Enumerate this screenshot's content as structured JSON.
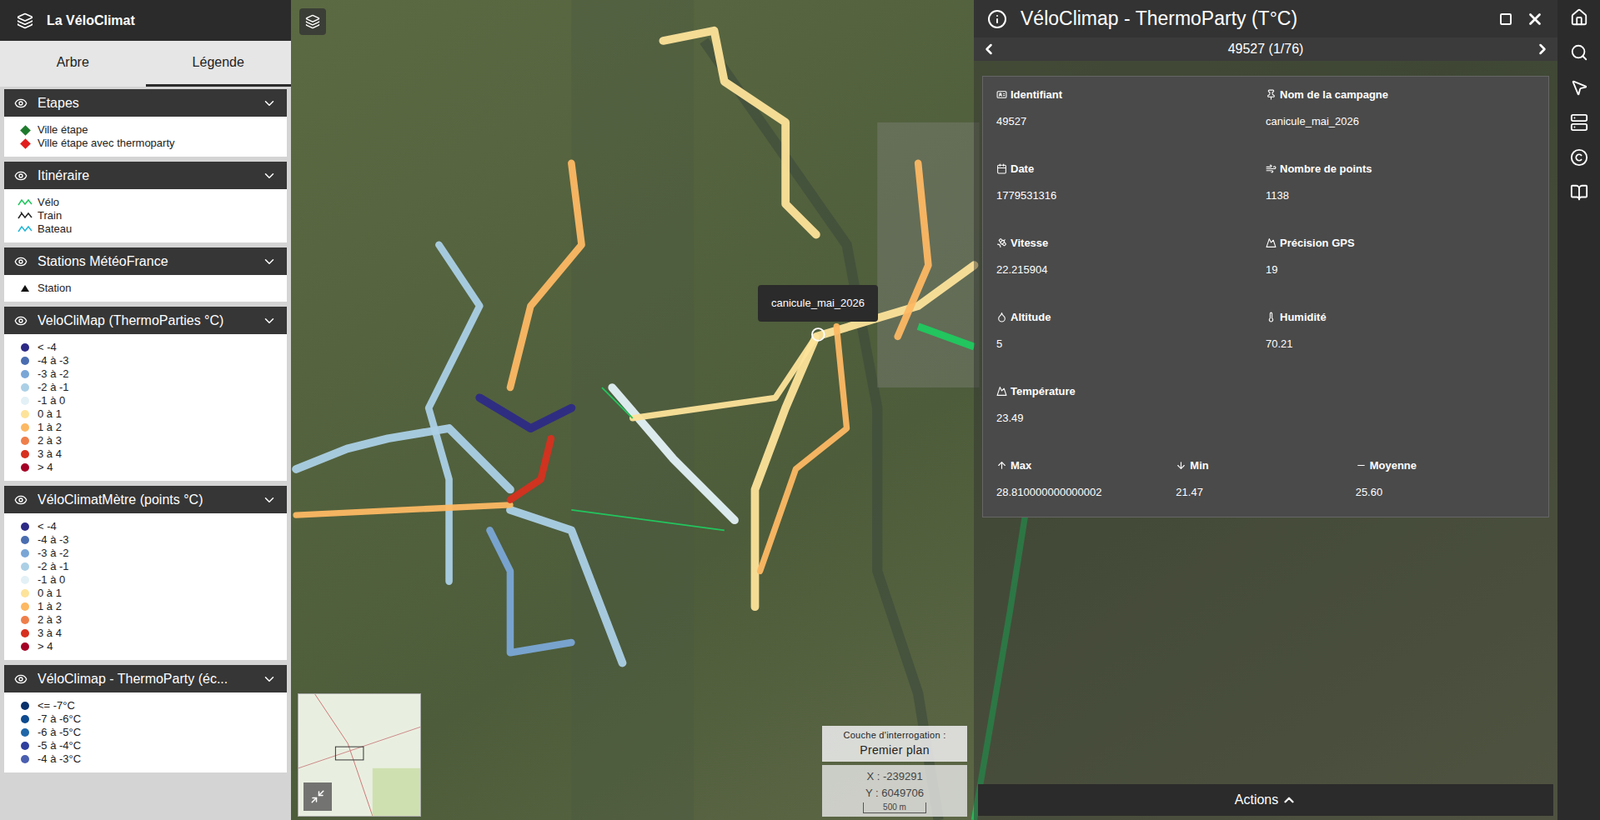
{
  "sidebar": {
    "title": "La VéloClimat",
    "tabs": [
      {
        "label": "Arbre",
        "selected": false
      },
      {
        "label": "Légende",
        "selected": true
      }
    ],
    "groups": [
      {
        "title": "Etapes",
        "expanded": true,
        "items": [
          {
            "label": "Ville étape",
            "kind": "diamond",
            "color": "#1f7a2e"
          },
          {
            "label": "Ville étape avec thermoparty",
            "kind": "diamond",
            "color": "#e11d1d"
          }
        ]
      },
      {
        "title": "Itinéraire",
        "expanded": true,
        "items": [
          {
            "label": "Vélo",
            "kind": "line",
            "color": "#22c55e"
          },
          {
            "label": "Train",
            "kind": "cross-line",
            "color": "#222222"
          },
          {
            "label": "Bateau",
            "kind": "line",
            "color": "#22b5d6"
          }
        ]
      },
      {
        "title": "Stations MétéoFrance",
        "expanded": true,
        "items": [
          {
            "label": "Station",
            "kind": "triangle",
            "color": "#111111"
          }
        ]
      },
      {
        "title": "VeloCliMap (ThermoParties °C)",
        "expanded": true,
        "items": [
          {
            "label": "< -4",
            "kind": "dot",
            "color": "#2d2a86"
          },
          {
            "label": "-4 à -3",
            "kind": "dot",
            "color": "#4a6db0"
          },
          {
            "label": "-3 à -2",
            "kind": "dot",
            "color": "#7aa6d6"
          },
          {
            "label": "-2 à -1",
            "kind": "dot",
            "color": "#abd0e6"
          },
          {
            "label": "-1 à 0",
            "kind": "dot",
            "color": "#e3f1f6"
          },
          {
            "label": "0 à 1",
            "kind": "dot",
            "color": "#fde39a"
          },
          {
            "label": "1 à 2",
            "kind": "dot",
            "color": "#fdb863"
          },
          {
            "label": "2 à 3",
            "kind": "dot",
            "color": "#ef7f4a"
          },
          {
            "label": "3 à 4",
            "kind": "dot",
            "color": "#d7301f"
          },
          {
            "label": "> 4",
            "kind": "dot",
            "color": "#a50026"
          }
        ]
      },
      {
        "title": "VéloClimatMètre (points °C)",
        "expanded": true,
        "items": [
          {
            "label": "< -4",
            "kind": "dot",
            "color": "#2d2a86"
          },
          {
            "label": "-4 à -3",
            "kind": "dot",
            "color": "#4a6db0"
          },
          {
            "label": "-3 à -2",
            "kind": "dot",
            "color": "#7aa6d6"
          },
          {
            "label": "-2 à -1",
            "kind": "dot",
            "color": "#abd0e6"
          },
          {
            "label": "-1 à 0",
            "kind": "dot",
            "color": "#e3f1f6"
          },
          {
            "label": "0 à 1",
            "kind": "dot",
            "color": "#fde39a"
          },
          {
            "label": "1 à 2",
            "kind": "dot",
            "color": "#fdb863"
          },
          {
            "label": "2 à 3",
            "kind": "dot",
            "color": "#ef7f4a"
          },
          {
            "label": "3 à 4",
            "kind": "dot",
            "color": "#d7301f"
          },
          {
            "label": "> 4",
            "kind": "dot",
            "color": "#a50026"
          }
        ]
      },
      {
        "title": "VéloClimap - ThermoParty (éc...",
        "expanded": true,
        "items": [
          {
            "label": "<= -7°C",
            "kind": "dot",
            "color": "#08306b"
          },
          {
            "label": "-7 à -6°C",
            "kind": "dot",
            "color": "#0d4a8f"
          },
          {
            "label": "-6 à -5°C",
            "kind": "dot",
            "color": "#1f66a8"
          },
          {
            "label": "-5 à -4°C",
            "kind": "dot",
            "color": "#2f3f9e"
          },
          {
            "label": "-4 à -3°C",
            "kind": "dot",
            "color": "#4a5fb0"
          }
        ]
      }
    ]
  },
  "map": {
    "tooltip": "canicule_mai_2026",
    "query_layer": {
      "label": "Couche d'interrogation :",
      "value": "Premier plan"
    },
    "coords": {
      "x": "X : -239291",
      "y": "Y : 6049706"
    },
    "scale": "500 m"
  },
  "panel": {
    "title": "VéloClimap - ThermoParty (T°C)",
    "nav": "49527 (1/76)",
    "fields": [
      {
        "label": "Identifiant",
        "value": "49527"
      },
      {
        "label": "Nom de la campagne",
        "value": "canicule_mai_2026"
      },
      {
        "label": "Date",
        "value": "1779531316"
      },
      {
        "label": "Nombre de points",
        "value": "1138"
      },
      {
        "label": "Vitesse",
        "value": "22.215904"
      },
      {
        "label": "Précision GPS",
        "value": "19"
      },
      {
        "label": "Altitude",
        "value": "5"
      },
      {
        "label": "Humidité",
        "value": "70.21"
      },
      {
        "label": "Température",
        "value": "23.49"
      }
    ],
    "stats": [
      {
        "label": "Max",
        "value": "28.810000000000002"
      },
      {
        "label": "Min",
        "value": "21.47"
      },
      {
        "label": "Moyenne",
        "value": "25.60"
      }
    ],
    "actions": "Actions"
  }
}
